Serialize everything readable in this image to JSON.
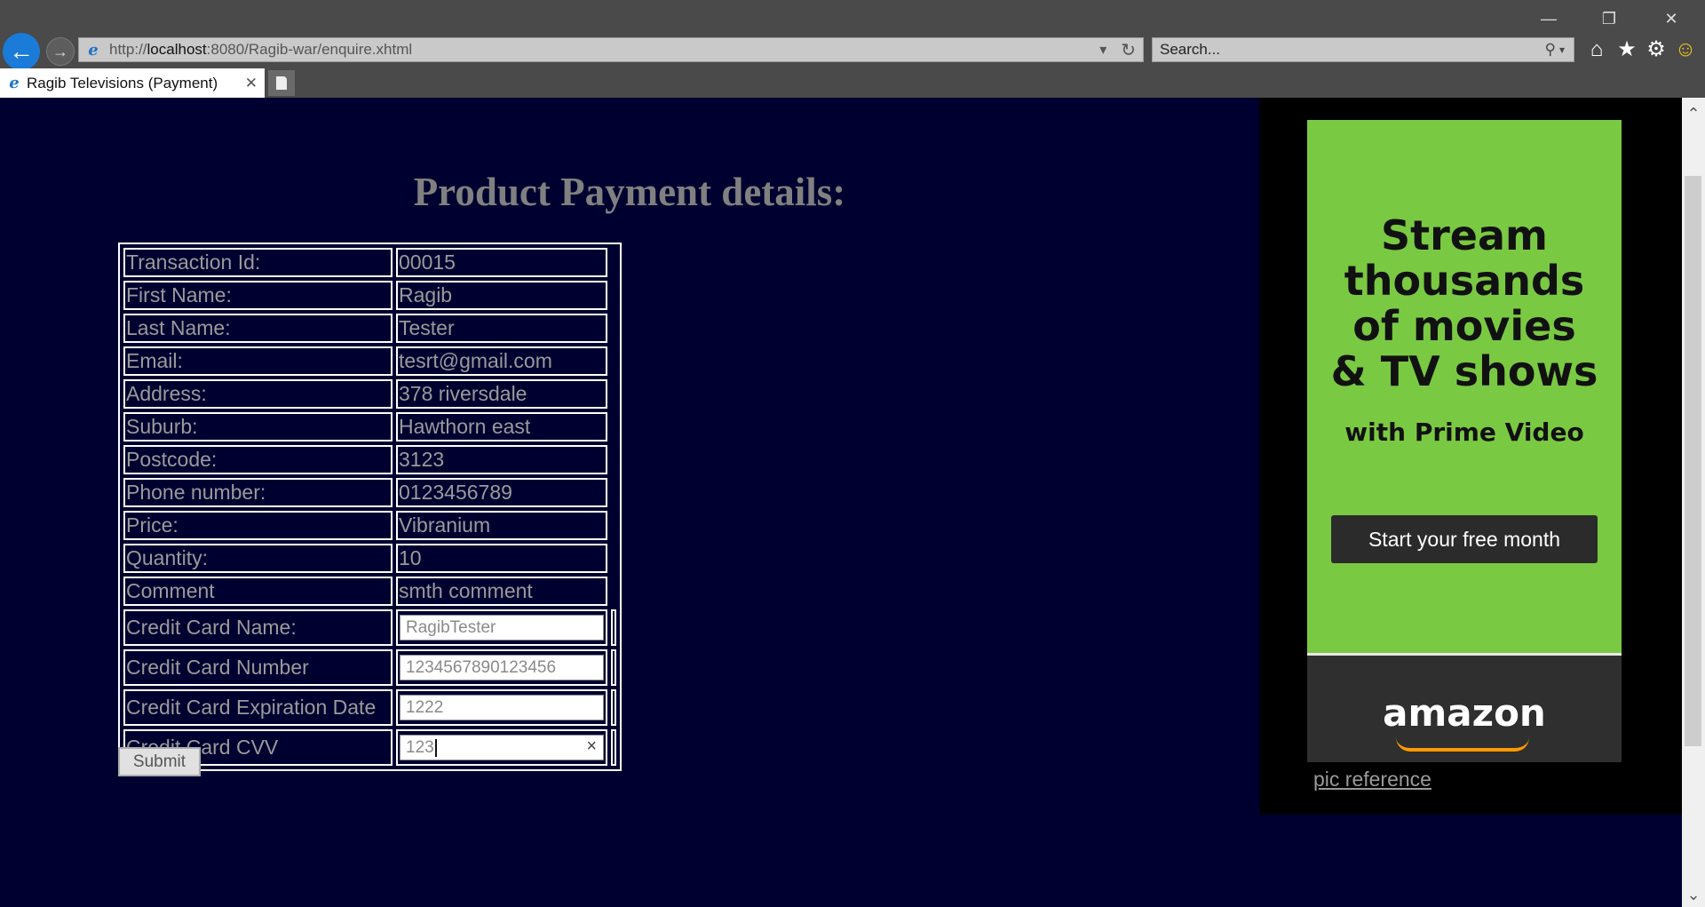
{
  "browser": {
    "url_prefix": "http://",
    "url_host": "localhost",
    "url_path": ":8080/Ragib-war/enquire.xhtml",
    "search_placeholder": "Search...",
    "tab_title": "Ragib Televisions (Payment)"
  },
  "page": {
    "title": "Product Payment details:",
    "rows": [
      {
        "label": "Transaction Id:",
        "value": "00015"
      },
      {
        "label": "First Name:",
        "value": "Ragib"
      },
      {
        "label": "Last Name:",
        "value": "Tester"
      },
      {
        "label": "Email:",
        "value": "tesrt@gmail.com"
      },
      {
        "label": "Address:",
        "value": "378 riversdale"
      },
      {
        "label": "Suburb:",
        "value": "Hawthorn east"
      },
      {
        "label": "Postcode:",
        "value": "3123"
      },
      {
        "label": "Phone number:",
        "value": "0123456789"
      },
      {
        "label": "Price:",
        "value": "Vibranium"
      },
      {
        "label": "Quantity:",
        "value": "10"
      },
      {
        "label": "Comment",
        "value": "smth comment"
      }
    ],
    "inputs": [
      {
        "label": "Credit Card Name:",
        "value": "RagibTester"
      },
      {
        "label": "Credit Card Number",
        "value": "1234567890123456"
      },
      {
        "label": "Credit Card Expiration Date",
        "value": "1222"
      },
      {
        "label": "Credit Card CVV",
        "value": "123"
      }
    ],
    "submit_label": "Submit"
  },
  "ad": {
    "headline_1": "Stream",
    "headline_2": "thousands",
    "headline_3": "of movies",
    "headline_4": "& TV shows",
    "subline": "with Prime Video",
    "cta": "Start your free month",
    "logo": "amazon",
    "pic_reference": "pic reference"
  },
  "icons": {
    "back": "back-arrow-icon",
    "forward": "forward-arrow-icon",
    "refresh": "refresh-icon",
    "search": "search-icon",
    "home": "home-icon",
    "favorites": "star-icon",
    "settings": "gear-icon",
    "feedback": "smiley-icon"
  }
}
